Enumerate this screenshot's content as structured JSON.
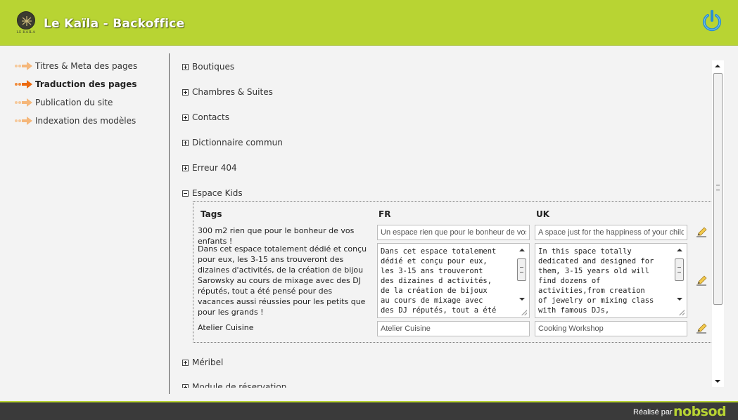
{
  "app": {
    "title": "Le Kaïla - Backoffice",
    "logo_text": "LE KAÏLA",
    "accent_color": "#b8d433",
    "power_icon": "power-icon"
  },
  "sidebar": {
    "items": [
      {
        "label": "Titres & Meta des pages",
        "active": false
      },
      {
        "label": "Traduction des pages",
        "active": true
      },
      {
        "label": "Publication du site",
        "active": false
      },
      {
        "label": "Indexation des modèles",
        "active": false
      }
    ]
  },
  "sections": [
    {
      "label": "Boutiques",
      "expanded": false
    },
    {
      "label": "Chambres & Suites",
      "expanded": false
    },
    {
      "label": "Contacts",
      "expanded": false
    },
    {
      "label": "Dictionnaire commun",
      "expanded": false
    },
    {
      "label": "Erreur 404",
      "expanded": false
    },
    {
      "label": "Espace Kids",
      "expanded": true
    },
    {
      "label": "Méribel",
      "expanded": false
    },
    {
      "label": "Module de réservation",
      "expanded": false
    }
  ],
  "translation_table": {
    "headers": {
      "tags": "Tags",
      "fr": "FR",
      "uk": "UK"
    },
    "rows": [
      {
        "tag": "300 m2 rien que pour le bonheur de vos enfants !",
        "fr": "Un espace rien que pour le bonheur de vos enfants",
        "uk": "A space just for the happiness of your children"
      },
      {
        "tag": "Dans cet espace totalement dédié et conçu pour eux, les 3-15 ans trouveront des dizaines d'activités, de la création de bijou Sarowsky au cours de mixage avec des DJ réputés, tout a été pensé pour des vacances aussi réussies pour les petits que pour les grands !",
        "fr": "Dans cet espace totalement\ndédié et conçu pour eux,\nles 3-15 ans trouveront\ndes dizaines d activités,\nde la création de bijoux\nau cours de mixage avec\ndes DJ réputés, tout a été",
        "uk": "In this space totally\ndedicated and designed for\nthem, 3-15 years old will\nfind dozens of\nactivities,from creation\nof jewelry or mixing class\nwith famous DJs,"
      },
      {
        "tag": "Atelier Cuisine",
        "fr": "Atelier Cuisine",
        "uk": "Cooking Workshop"
      }
    ]
  },
  "footer": {
    "credit": "Réalisé par",
    "brand": "nobsod"
  }
}
